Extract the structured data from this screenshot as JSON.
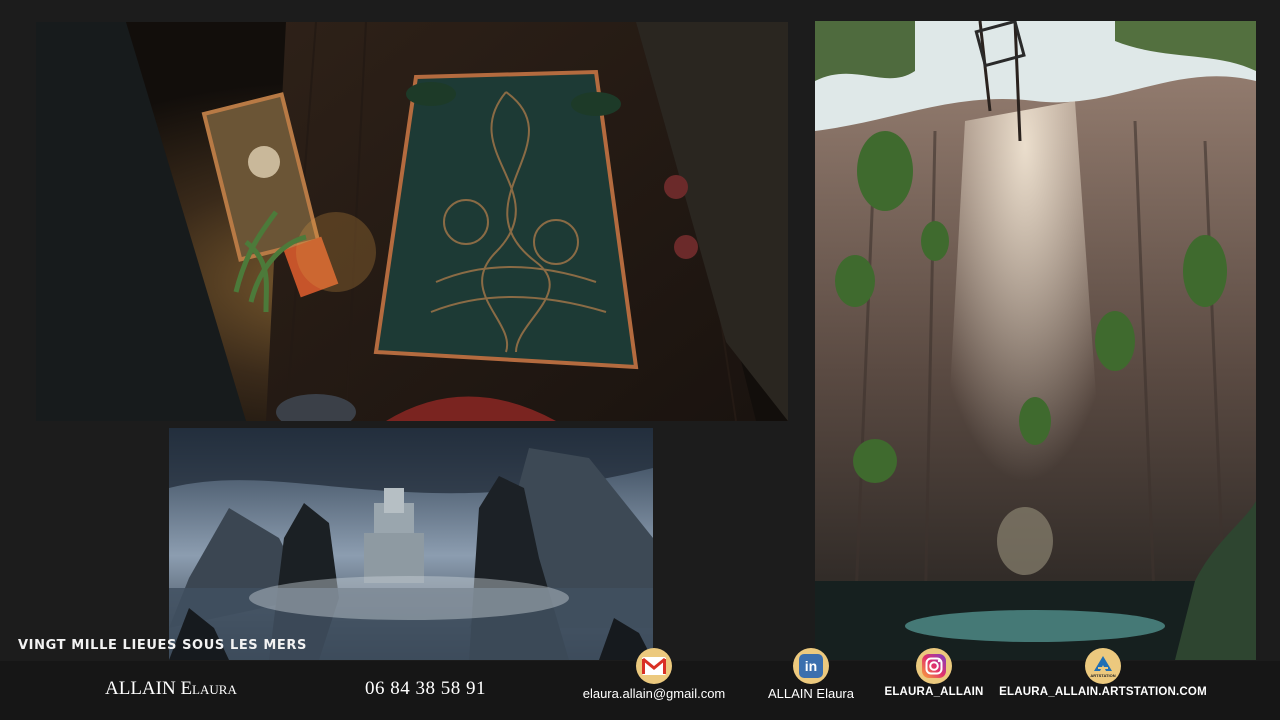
{
  "project": {
    "title": "VINGT MILLE LIEUES SOUS LES MERS"
  },
  "footer": {
    "name_main": "ALLAIN",
    "name_rest": "Elaura",
    "phone": "06 84 38 58 91",
    "contacts": [
      {
        "icon": "gmail-icon",
        "label": "elaura.allain@gmail.com"
      },
      {
        "icon": "linkedin-icon",
        "label": "ALLAIN Elaura"
      },
      {
        "icon": "instagram-icon",
        "label": "ELAURA_ALLAIN"
      },
      {
        "icon": "artstation-icon",
        "label": "ELAURA_ALLAIN.ARTSTATION.COM",
        "icon_text": "ARTSTATION"
      }
    ]
  },
  "colors": {
    "background": "#1c1c1c",
    "footer": "#161616",
    "icon_badge": "#ecc97e",
    "text": "#ffffff"
  }
}
